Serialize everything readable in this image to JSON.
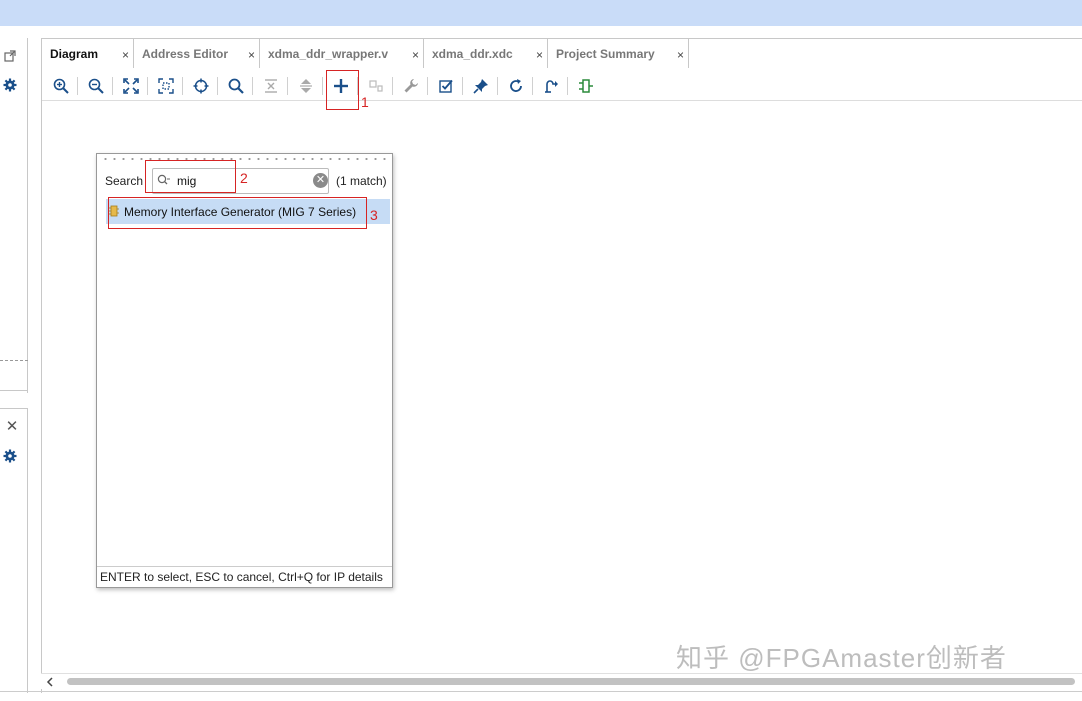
{
  "tabs": [
    {
      "label": "Diagram",
      "active": true
    },
    {
      "label": "Address Editor",
      "active": false
    },
    {
      "label": "xdma_ddr_wrapper.v",
      "active": false
    },
    {
      "label": "xdma_ddr.xdc",
      "active": false
    },
    {
      "label": "Project Summary",
      "active": false
    }
  ],
  "tab_close_glyph": "×",
  "toolbar_icons": [
    "zoom-in-icon",
    "zoom-out-icon",
    "fit-view-icon",
    "fit-selection-icon",
    "center-icon",
    "search-icon",
    "collapse-icon",
    "expand-icon",
    "add-ip-icon",
    "add-module-icon",
    "wrench-icon",
    "validate-icon",
    "pin-icon",
    "refresh-icon",
    "regenerate-layout-icon",
    "port-icon"
  ],
  "annotations": {
    "one": "1",
    "two": "2",
    "three": "3"
  },
  "popup": {
    "search_label": "Search",
    "search_value": "mig",
    "match_count": "(1 match)",
    "result": "Memory Interface Generator (MIG 7 Series)",
    "footer": "ENTER to select, ESC to cancel, Ctrl+Q for IP details"
  },
  "watermark": "知乎 @FPGAmaster创新者",
  "colors": {
    "accent": "#1a4f8a",
    "highlight": "#c6dcf5",
    "annotation": "#d62424",
    "topbar": "#c9dcf8"
  }
}
